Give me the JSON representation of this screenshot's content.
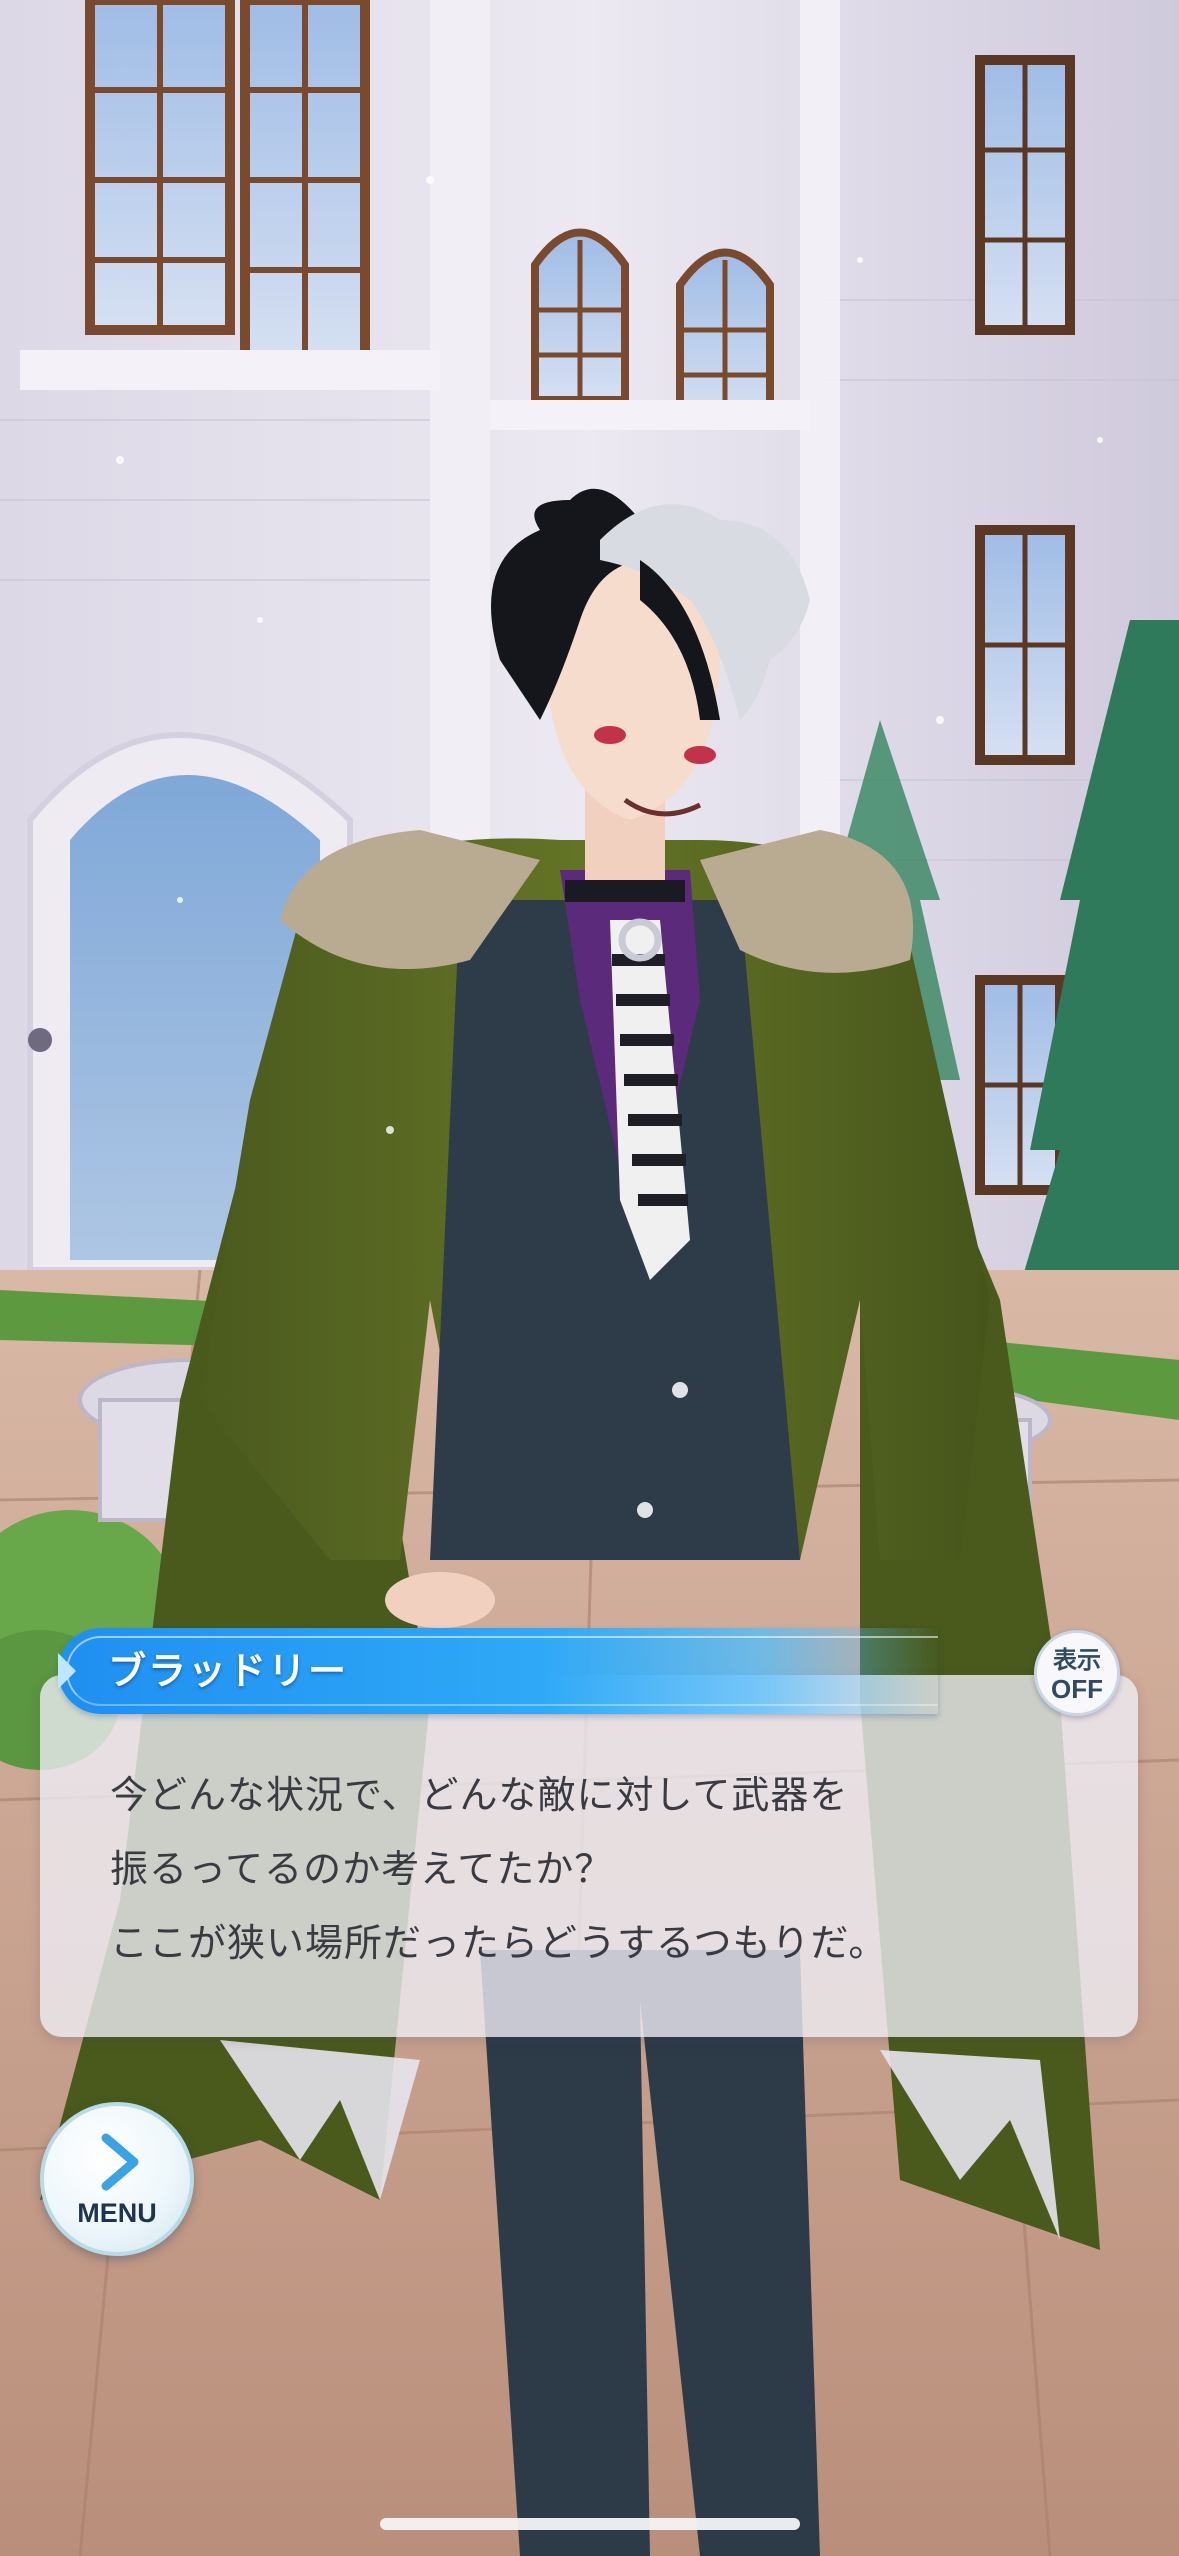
{
  "speaker": {
    "name": "ブラッドリー"
  },
  "dialogue": {
    "lines": [
      "今どんな状況で、どんな敵に対して武器を",
      "振るってるのか考えてたか？",
      "ここが狭い場所だったらどうするつもりだ。"
    ]
  },
  "display_toggle": {
    "label_top": "表示",
    "label_bottom": "OFF"
  },
  "menu": {
    "label": "MENU",
    "icon": "chevron-right-icon"
  },
  "colors": {
    "name_banner": "#2a9ff5",
    "dialogue_bg": "#eeecf4",
    "dialogue_text": "#3a3a42",
    "menu_text": "#1d3550"
  }
}
